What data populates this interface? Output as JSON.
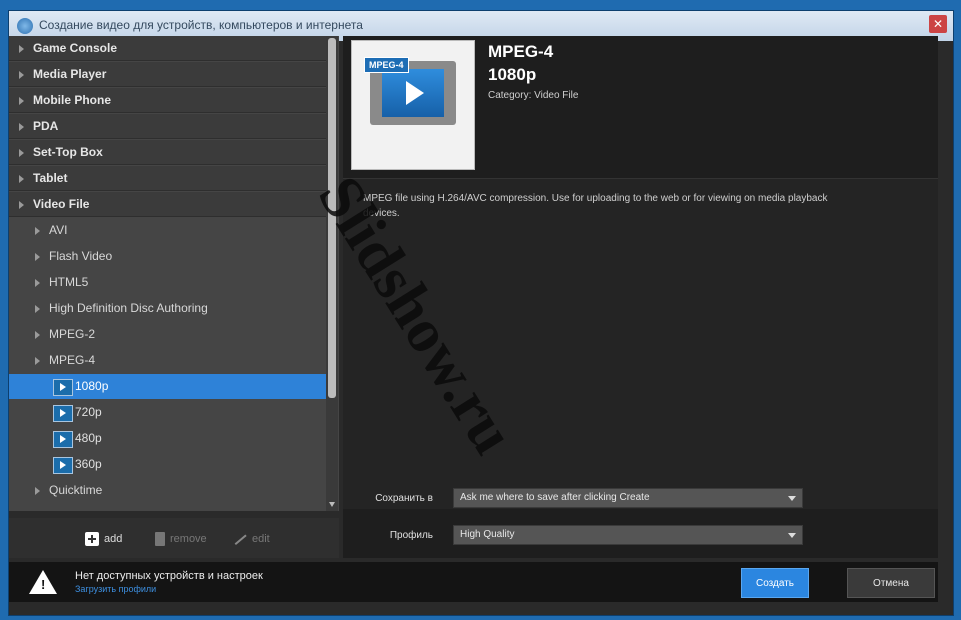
{
  "window": {
    "title": "Создание видео для устройств, компьютеров и интернета",
    "close_glyph": "✕"
  },
  "tree": {
    "categories": [
      "Game Console",
      "Media Player",
      "Mobile Phone",
      "PDA",
      "Set-Top Box",
      "Tablet",
      "Video File"
    ],
    "video_file_children": [
      "AVI",
      "Flash Video",
      "HTML5",
      "High Definition Disc Authoring",
      "MPEG-2",
      "MPEG-4"
    ],
    "mpeg4_presets": [
      "1080p",
      "720p",
      "480p",
      "360p"
    ],
    "selected_preset": "1080p",
    "after": [
      "Quicktime"
    ]
  },
  "left_toolbar": {
    "add": "add",
    "remove": "remove",
    "edit": "edit"
  },
  "preset": {
    "thumb_tag": "MPEG-4",
    "format": "MPEG-4",
    "resolution": "1080p",
    "category": "Category: Video File",
    "description": "MPEG file using H.264/AVC compression. Use for uploading to the web or for viewing on media playback devices."
  },
  "form": {
    "save_label": "Сохранить в",
    "save_value": "Ask me where to save after clicking Create",
    "profile_label": "Профиль",
    "profile_value": "High Quality"
  },
  "footer": {
    "warning": "Нет доступных устройств и настроек",
    "link": "Загрузить профили",
    "create": "Создать",
    "cancel": "Отмена"
  },
  "watermark": "Slidshow.ru",
  "colors": {
    "selection": "#2e82d8",
    "primary_button": "#2b86e0",
    "link": "#3d8fe0"
  }
}
